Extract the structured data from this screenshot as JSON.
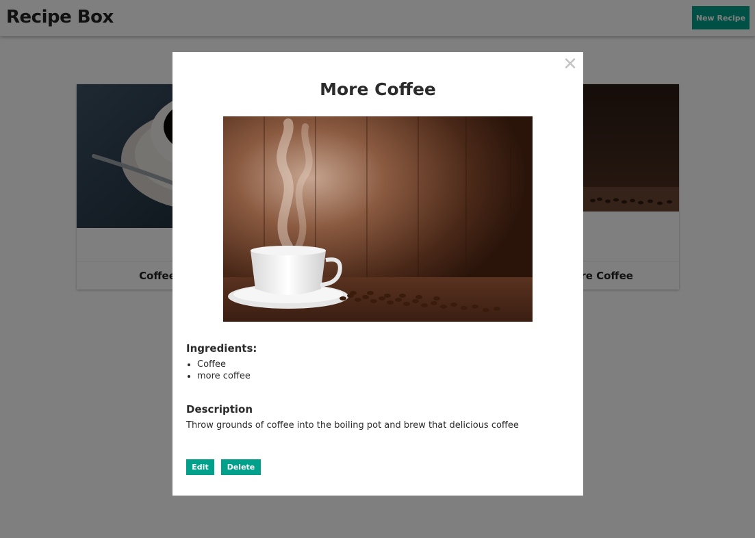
{
  "header": {
    "title": "Recipe Box",
    "new_recipe_label": "New Recipe"
  },
  "cards": [
    {
      "title": "Coffee",
      "image": "coffee-cup-photo"
    },
    {
      "title": "More Coffee",
      "image": "coffee-beans-photo"
    }
  ],
  "modal": {
    "title": "More Coffee",
    "image": "steaming-coffee-cup-photo",
    "close_symbol": "✕",
    "ingredients_heading": "Ingredients:",
    "ingredients": [
      "Coffee",
      "more coffee"
    ],
    "description_heading": "Description",
    "description": "Throw grounds of coffee into the boiling pot and brew that delicious coffee",
    "edit_label": "Edit",
    "delete_label": "Delete"
  },
  "colors": {
    "accent": "#00a08a",
    "overlay": "rgba(0,0,0,0.5)"
  }
}
